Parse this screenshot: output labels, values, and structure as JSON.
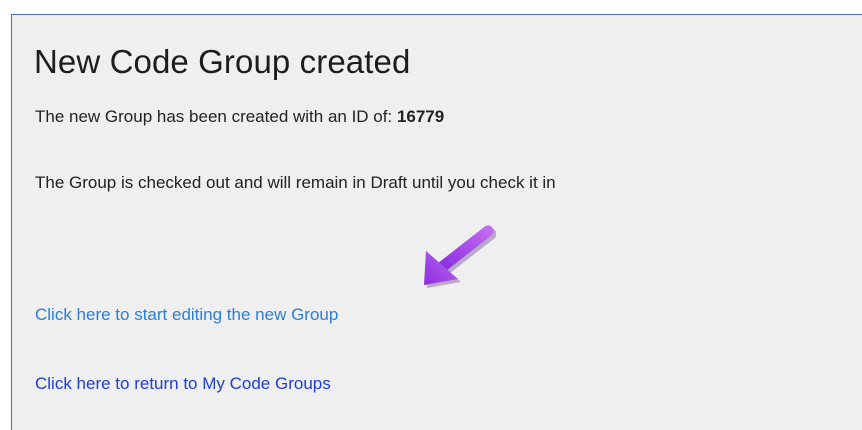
{
  "page": {
    "title": "New Code Group created",
    "created_message_prefix": "The new Group has been created with an ID of: ",
    "group_id": "16779",
    "draft_message": "The Group is checked out and will remain in Draft until you check it in",
    "annotation_icon": "purple-arrow-icon",
    "edit_link": "Click here to start editing the new Group",
    "return_link": "Click here to return to My Code Groups"
  },
  "colors": {
    "accent_border": "#4a6fc7",
    "link_edit": "#2b7fd6",
    "link_return": "#1e3fd0",
    "arrow": "#a23fe0"
  }
}
